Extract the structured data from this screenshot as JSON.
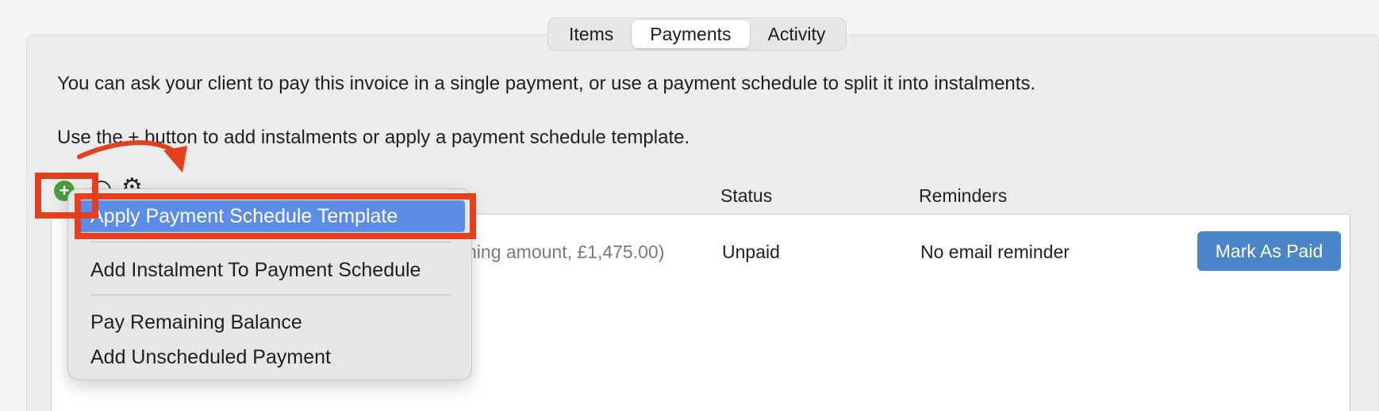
{
  "tabs": [
    {
      "label": "Items",
      "active": false
    },
    {
      "label": "Payments",
      "active": true
    },
    {
      "label": "Activity",
      "active": false
    }
  ],
  "description": {
    "line1": "You can ask your client to pay this invoice in a single payment, or use a payment schedule to split it into instalments.",
    "line2": "Use the + button to add instalments or apply a payment schedule template."
  },
  "toolbar": {
    "add_icon": "plus-circle-icon",
    "remove_icon": "minus-circle-icon",
    "settings_icon": "gear-icon"
  },
  "columns": {
    "status": "Status",
    "reminders": "Reminders"
  },
  "rows": [
    {
      "remaining": "ning amount, £1,475.00)",
      "status": "Unpaid",
      "reminder": "No email reminder",
      "action": "Mark As Paid"
    }
  ],
  "menu": {
    "items": [
      "Apply Payment Schedule Template",
      "Add Instalment To Payment Schedule",
      "Pay Remaining Balance",
      "Add Unscheduled Payment"
    ],
    "highlighted_index": 0
  },
  "colors": {
    "accent": "#4a86c5",
    "menu_highlight": "#5b8ce6",
    "annotation": "#e3401f",
    "add_icon": "#4c9a3f"
  }
}
